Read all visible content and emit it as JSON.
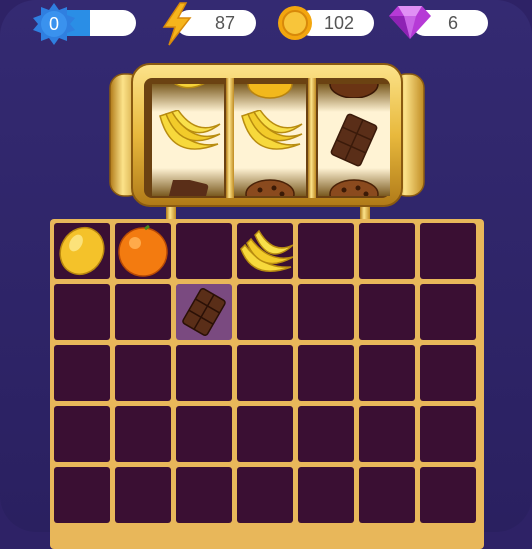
{
  "hud": {
    "level": "0",
    "level_progress": 0.5,
    "energy": "87",
    "coins": "102",
    "gems": "6",
    "icons": {
      "level": "star-badge-icon",
      "energy": "lightning-icon",
      "coins": "coin-icon",
      "gems": "gem-icon"
    }
  },
  "slot_machine": {
    "reels": [
      {
        "top": "banana",
        "middle": "banana",
        "bottom": "chocolate"
      },
      {
        "top": "lemon",
        "middle": "banana",
        "bottom": "cookie"
      },
      {
        "top": "cookie",
        "middle": "chocolate",
        "bottom": "cookie"
      }
    ]
  },
  "board": {
    "columns": 7,
    "rows": 5,
    "items": [
      {
        "row": 0,
        "col": 0,
        "item": "lemon"
      },
      {
        "row": 0,
        "col": 1,
        "item": "orange"
      },
      {
        "row": 0,
        "col": 3,
        "item": "banana"
      },
      {
        "row": 1,
        "col": 2,
        "item": "chocolate",
        "selected": true
      }
    ]
  },
  "colors": {
    "background": "#2e2266",
    "board_border": "#e8b75a",
    "cell": "#3a0f33",
    "cell_selected": "#7a4a80",
    "level_fill": "#2a8ee6"
  }
}
